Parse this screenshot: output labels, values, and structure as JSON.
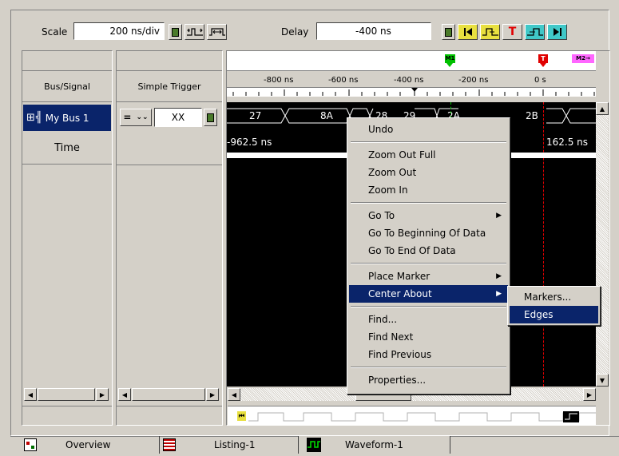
{
  "toolbar": {
    "scale_label": "Scale",
    "scale_value": "200 ns/div",
    "delay_label": "Delay",
    "delay_value": "-400 ns"
  },
  "headers": {
    "bus_signal": "Bus/Signal",
    "simple_trigger": "Simple Trigger"
  },
  "signals": {
    "bus_name": "My Bus 1",
    "time_label": "Time",
    "trigger_operator": "=",
    "trigger_value": "XX"
  },
  "ruler": {
    "ticks": [
      "-800 ns",
      "-600 ns",
      "-400 ns",
      "-200 ns",
      "0 s"
    ],
    "marker_m1": "M1",
    "marker_t": "T",
    "marker_m2": "M2→"
  },
  "waveform": {
    "bus_values": [
      "27",
      "8A",
      "28",
      "29",
      "2A",
      "2B"
    ],
    "time_left": "-962.5 ns",
    "time_right": "162.5 ns"
  },
  "context_menu": {
    "items": [
      "Undo",
      "Zoom Out Full",
      "Zoom Out",
      "Zoom In",
      "Go To",
      "Go To Beginning Of Data",
      "Go To End Of Data",
      "Place Marker",
      "Center About",
      "Find...",
      "Find Next",
      "Find Previous",
      "Properties..."
    ]
  },
  "submenu": {
    "items": [
      "Markers...",
      "Edges"
    ]
  },
  "tabs": [
    "Overview",
    "Listing-1",
    "Waveform-1"
  ],
  "colors": {
    "menu_highlight": "#0a246a",
    "waveform_bg": "#000000",
    "marker_m1": "#00c000",
    "marker_t": "#e00000",
    "marker_m2": "#ff66ff"
  }
}
